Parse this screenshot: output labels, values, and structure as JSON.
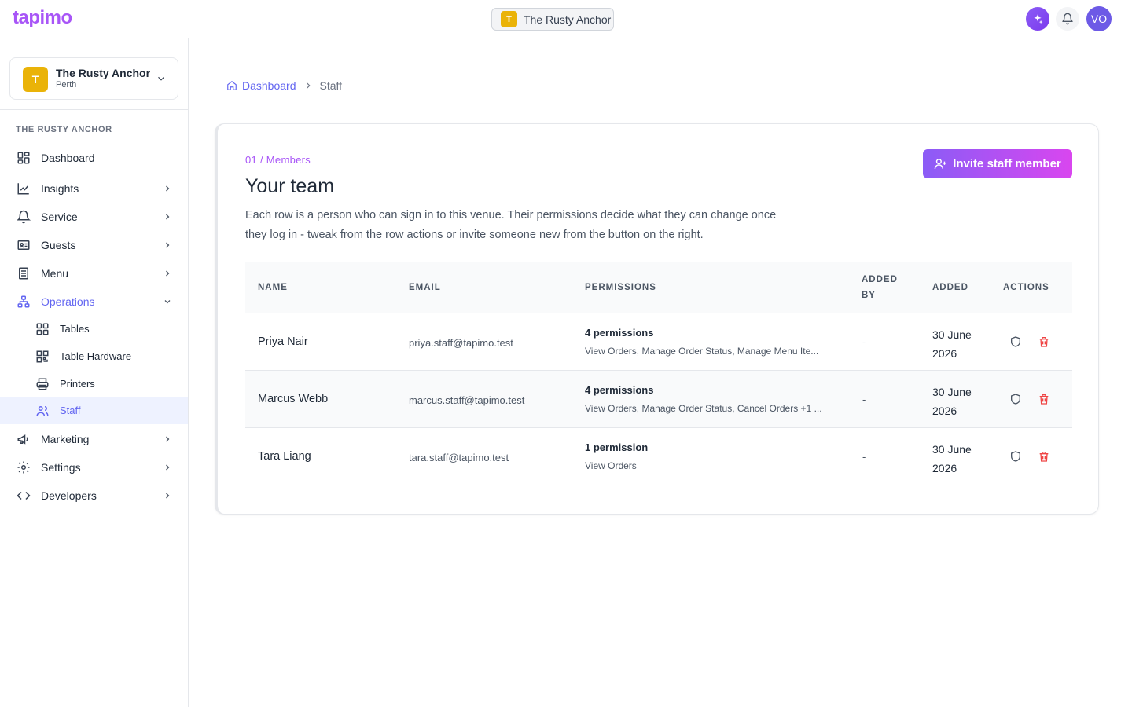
{
  "topbar": {
    "logo": "tapimo",
    "venue_initial": "T",
    "venue_name": "The Rusty Anchor",
    "avatar_initials": "VO"
  },
  "sidebar": {
    "venue_initial": "T",
    "venue_name": "The Rusty Anchor",
    "venue_city": "Perth",
    "section_label": "THE RUSTY ANCHOR",
    "items": [
      {
        "label": "Dashboard"
      },
      {
        "label": "Insights"
      },
      {
        "label": "Service"
      },
      {
        "label": "Guests"
      },
      {
        "label": "Menu"
      },
      {
        "label": "Operations"
      },
      {
        "label": "Marketing"
      },
      {
        "label": "Settings"
      },
      {
        "label": "Developers"
      }
    ],
    "operations_sub": [
      {
        "label": "Tables"
      },
      {
        "label": "Table Hardware"
      },
      {
        "label": "Printers"
      },
      {
        "label": "Staff"
      }
    ]
  },
  "breadcrumb": {
    "home": "Dashboard",
    "current": "Staff"
  },
  "card": {
    "eyebrow": "01 / Members",
    "title": "Your team",
    "description": "Each row is a person who can sign in to this venue. Their permissions decide what they can change once they log in - tweak from the row actions or invite someone new from the button on the right.",
    "invite_label": "Invite staff member"
  },
  "table": {
    "headers": {
      "name": "NAME",
      "email": "EMAIL",
      "permissions": "PERMISSIONS",
      "added_by_1": "ADDED",
      "added_by_2": "BY",
      "added": "ADDED",
      "actions": "ACTIONS"
    },
    "rows": [
      {
        "name": "Priya Nair",
        "email": "priya.staff@tapimo.test",
        "perm_count": "4 permissions",
        "perm_list": "View Orders, Manage Order Status, Manage Menu Ite...",
        "added_by": "-",
        "added": "30 June 2026"
      },
      {
        "name": "Marcus Webb",
        "email": "marcus.staff@tapimo.test",
        "perm_count": "4 permissions",
        "perm_list": "View Orders, Manage Order Status, Cancel Orders +1 ...",
        "added_by": "-",
        "added": "30 June 2026"
      },
      {
        "name": "Tara Liang",
        "email": "tara.staff@tapimo.test",
        "perm_count": "1 permission",
        "perm_list": "View Orders",
        "added_by": "-",
        "added": "30 June 2026"
      }
    ]
  },
  "colors": {
    "accent": "#6366f1",
    "brand": "#a855f7",
    "venue_badge": "#eab308",
    "danger": "#ef4444"
  }
}
